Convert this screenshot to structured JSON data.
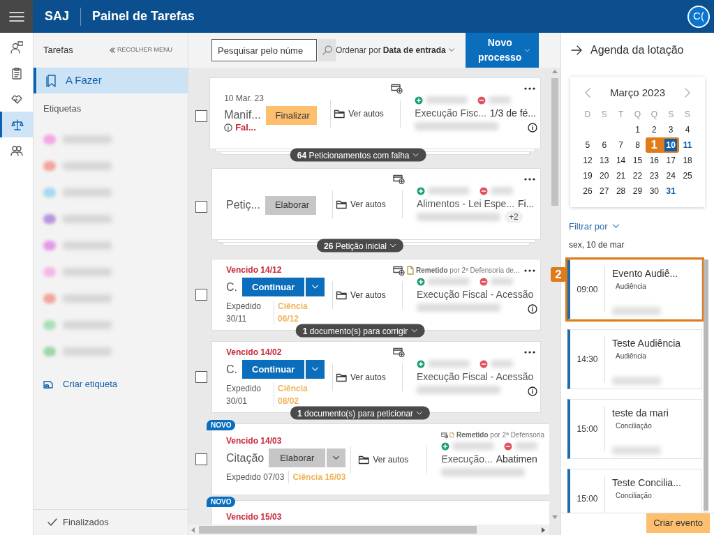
{
  "header": {
    "app": "SAJ",
    "title": "Painel de Tarefas",
    "avatar": "C("
  },
  "rail": [
    {
      "selected": false
    },
    {
      "selected": false
    },
    {
      "selected": false
    },
    {
      "selected": true
    },
    {
      "selected": false
    }
  ],
  "sidebar": {
    "title": "Tarefas",
    "collapse": "RECOLHER MENU",
    "items": [
      {
        "label": "A Fazer",
        "selected": true
      }
    ],
    "tags_title": "Etiquetas",
    "tags": [
      {
        "color": "#f4a6e6"
      },
      {
        "color": "#f2a59a"
      },
      {
        "color": "#a6d8f0"
      },
      {
        "color": "#b597e0"
      },
      {
        "color": "#e49ae8"
      },
      {
        "color": "#f6b7e8"
      },
      {
        "color": "#f0a69b"
      },
      {
        "color": "#a9e0b8"
      },
      {
        "color": "#9fd6a8"
      }
    ],
    "create_tag": "Criar etiqueta",
    "footer": "Finalizados"
  },
  "toolbar": {
    "search_placeholder": "Pesquisar pelo núme",
    "sort_label": "Ordenar por",
    "sort_value": "Data de entrada",
    "new_button": "Novo processo"
  },
  "tasks": [
    {
      "kind": "standard",
      "checked": false,
      "stacked": true,
      "top_line": "10 Mar. 23",
      "overdue": false,
      "title": "Manif...",
      "button": {
        "label": "Finalizar",
        "kind": "finish",
        "split": false
      },
      "status": "Fal...",
      "class_name": "Execução Fisc...",
      "subject": "1/3 de fé...",
      "info": true,
      "group": "**64** Peticionamentos com falha",
      "link": "Ver autos"
    },
    {
      "kind": "standard",
      "checked": false,
      "stacked": true,
      "title": "Petiç...",
      "button": {
        "label": "Elaborar",
        "kind": "draft",
        "split": false
      },
      "class_name": "Alimentos - Lei Espe...",
      "subject": "Fi...",
      "more": "+2",
      "info": false,
      "group": "**26** Petição inicial",
      "link": "Ver autos"
    },
    {
      "kind": "standard",
      "checked": false,
      "stacked": false,
      "top_line": "Vencido 14/12",
      "overdue": true,
      "title": "C.",
      "button": {
        "label": "Continuar",
        "kind": "continue",
        "split": true
      },
      "issued": "Expedido 30/11",
      "acknowledged": "Ciência 06/12",
      "sent": {
        "label": "Remetido",
        "by": "por 2ª Defensoria de..."
      },
      "class_name": "Execução Fiscal - Acessão",
      "info": true,
      "group": "**1** documento(s) para corrigir",
      "link": "Ver autos"
    },
    {
      "kind": "standard",
      "checked": false,
      "stacked": false,
      "top_line": "Vencido 14/02",
      "overdue": true,
      "title": "C.",
      "button": {
        "label": "Continuar",
        "kind": "continue",
        "split": true
      },
      "issued": "Expedido 30/01",
      "acknowledged": "Ciência 08/02",
      "class_name": "Execução Fiscal - Acessão",
      "info": true,
      "group": "**1** documento(s) para peticionar",
      "link": "Ver autos"
    },
    {
      "kind": "wide",
      "checked": false,
      "stacked": false,
      "badge": "NOVO",
      "top_line": "Vencido 14/03",
      "overdue": true,
      "title": "Citação",
      "button": {
        "label": "Elaborar",
        "kind": "draft",
        "split": true
      },
      "issued": "Expedido 07/03",
      "acknowledged": "Ciência 16/03",
      "sent": {
        "label": "Remetido",
        "by": "por 2ª Defensoria"
      },
      "class_name": "Execução...",
      "subject": "Abatimen",
      "info": false,
      "link": "Ver autos"
    },
    {
      "kind": "partial",
      "badge": "NOVO",
      "top_line": "Vencido 15/03",
      "overdue": true
    }
  ],
  "agenda": {
    "title": "Agenda da lotação",
    "month": "Março 2023",
    "weekdays": [
      "D",
      "S",
      "T",
      "Q",
      "Q",
      "S",
      "S"
    ],
    "days": [
      {
        "kind": "blank"
      },
      {
        "kind": "blank"
      },
      {
        "kind": "blank"
      },
      {
        "kind": "day",
        "label": "1",
        "selected": false,
        "marked": false
      },
      {
        "kind": "day",
        "label": "2",
        "selected": false,
        "marked": false
      },
      {
        "kind": "day",
        "label": "3",
        "selected": false,
        "marked": false
      },
      {
        "kind": "day",
        "label": "4",
        "selected": false,
        "marked": false
      },
      {
        "kind": "day",
        "label": "5",
        "selected": false,
        "marked": false
      },
      {
        "kind": "day",
        "label": "6",
        "selected": false,
        "marked": false
      },
      {
        "kind": "day",
        "label": "7",
        "selected": false,
        "marked": false
      },
      {
        "kind": "day",
        "label": "8",
        "selected": false,
        "marked": false
      },
      {
        "kind": "callout",
        "label": "1"
      },
      {
        "kind": "day",
        "label": "10",
        "selected": true,
        "marked": false
      },
      {
        "kind": "day",
        "label": "11",
        "selected": false,
        "marked": true
      },
      {
        "kind": "day",
        "label": "12",
        "selected": false,
        "marked": false
      },
      {
        "kind": "day",
        "label": "13",
        "selected": false,
        "marked": false
      },
      {
        "kind": "day",
        "label": "14",
        "selected": false,
        "marked": false
      },
      {
        "kind": "day",
        "label": "15",
        "selected": false,
        "marked": false
      },
      {
        "kind": "day",
        "label": "16",
        "selected": false,
        "marked": false
      },
      {
        "kind": "day",
        "label": "17",
        "selected": false,
        "marked": false
      },
      {
        "kind": "day",
        "label": "18",
        "selected": false,
        "marked": false
      },
      {
        "kind": "day",
        "label": "19",
        "selected": false,
        "marked": false
      },
      {
        "kind": "day",
        "label": "20",
        "selected": false,
        "marked": false
      },
      {
        "kind": "day",
        "label": "21",
        "selected": false,
        "marked": false
      },
      {
        "kind": "day",
        "label": "22",
        "selected": false,
        "marked": false
      },
      {
        "kind": "day",
        "label": "23",
        "selected": false,
        "marked": false
      },
      {
        "kind": "day",
        "label": "24",
        "selected": false,
        "marked": false
      },
      {
        "kind": "day",
        "label": "25",
        "selected": false,
        "marked": false
      },
      {
        "kind": "day",
        "label": "26",
        "selected": false,
        "marked": false
      },
      {
        "kind": "day",
        "label": "27",
        "selected": false,
        "marked": false
      },
      {
        "kind": "day",
        "label": "28",
        "selected": false,
        "marked": false
      },
      {
        "kind": "day",
        "label": "29",
        "selected": false,
        "marked": false
      },
      {
        "kind": "day",
        "label": "30",
        "selected": false,
        "marked": false
      },
      {
        "kind": "day",
        "label": "31",
        "selected": false,
        "marked": true
      }
    ],
    "filter": "Filtrar por",
    "date": "sex, 10 de mar",
    "events": [
      {
        "time": "09:00",
        "title": "Evento Audiê...",
        "category": "Audiência",
        "callout": "2"
      },
      {
        "time": "14:30",
        "title": "Teste Audiência",
        "category": "Audiência"
      },
      {
        "time": "15:00",
        "title": "teste da mari",
        "category": "Conciliação"
      },
      {
        "time": "15:00",
        "title": "Teste Concilia...",
        "category": "Conciliação"
      }
    ],
    "create": "Criar evento"
  }
}
